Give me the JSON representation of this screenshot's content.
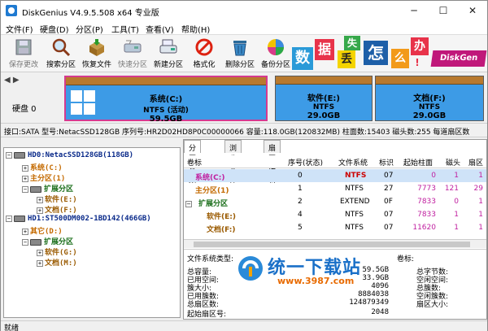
{
  "window": {
    "title": "DiskGenius V4.9.5.508 x64 专业版",
    "minimize": "─",
    "maximize": "☐",
    "close": "✕"
  },
  "menu": [
    "文件(F)",
    "硬盘(D)",
    "分区(P)",
    "工具(T)",
    "查看(V)",
    "帮助(H)"
  ],
  "toolbar": {
    "save": "保存更改",
    "search": "搜索分区",
    "recover": "恢复文件",
    "quick": "快速分区",
    "new": "新建分区",
    "format": "格式化",
    "delete": "删除分区",
    "backup": "备份分区"
  },
  "banner": {
    "c1": "数",
    "c2": "据",
    "c3": "丢",
    "c4": "失",
    "c5": "怎",
    "c6": "么",
    "c7": "办",
    "c8": "!",
    "brand": "DiskGen"
  },
  "disk": {
    "nav": "◀ ▶",
    "label": "硬盘 0",
    "partitions": [
      {
        "name": "系统(C:)",
        "fs": "NTFS (活动)",
        "size": "59.5GB"
      },
      {
        "name": "软件(E:)",
        "fs": "NTFS",
        "size": "29.0GB"
      },
      {
        "name": "文档(F:)",
        "fs": "NTFS",
        "size": "29.0GB"
      }
    ],
    "info": "接口:SATA  型号:NetacSSD128GB  序列号:HR2D02HD8P0C00000066  容量:118.0GB(120832MB)  柱面数:15403  磁头数:255  每道扇区数"
  },
  "tree": {
    "hd0": "HD0:NetacSSD128GB(118GB)",
    "sys": "系统(C:)",
    "primary": "主分区(1)",
    "ext": "扩展分区",
    "sw": "软件(E:)",
    "doc": "文档(F:)",
    "hd1": "HD1:ST500DM002-1BD142(466GB)",
    "other": "其它(D:)",
    "ext2": "扩展分区",
    "sw2": "软件(G:)",
    "doc2": "文档(M:)"
  },
  "tabs": [
    "分区参数",
    "浏览文件",
    "扇区编辑"
  ],
  "table": {
    "headers": [
      "卷标",
      "序号(状态)",
      "文件系统",
      "标识",
      "起始柱面",
      "磁头",
      "扇区"
    ],
    "rows": [
      {
        "label": "系统(C:)",
        "no": "0",
        "fs": "NTFS",
        "id": "07",
        "cyl": "0",
        "head": "1",
        "sec": "1"
      },
      {
        "label": "主分区(1)",
        "no": "1",
        "fs": "NTFS",
        "id": "27",
        "cyl": "7773",
        "head": "121",
        "sec": "29"
      },
      {
        "label": "扩展分区",
        "no": "2",
        "fs": "EXTEND",
        "id": "0F",
        "cyl": "7833",
        "head": "0",
        "sec": "1"
      },
      {
        "label": "软件(E:)",
        "no": "4",
        "fs": "NTFS",
        "id": "07",
        "cyl": "7833",
        "head": "1",
        "sec": "1"
      },
      {
        "label": "文档(F:)",
        "no": "5",
        "fs": "NTFS",
        "id": "07",
        "cyl": "11620",
        "head": "1",
        "sec": "1"
      }
    ]
  },
  "details": {
    "fstype": "文件系统类型:",
    "fstype_r": "卷标:",
    "total": "总容量:",
    "total_v": "59.5GB",
    "total_r": "总字节数:",
    "free": "已用空间:",
    "free_v": "33.9GB",
    "free_r": "空闲空间:",
    "cluster": "簇大小:",
    "cluster_v": "4096",
    "cluster_r": "总簇数:",
    "used": "已用簇数:",
    "used_v": "8884038",
    "used_r": "空闲簇数:",
    "sectors": "总扇区数:",
    "sectors_v": "124879349",
    "sectors_r": "扇区大小:",
    "start": "起始扇区号:",
    "start_v": "2048"
  },
  "watermark": {
    "main": "统一下载站",
    "url": "www.3987.com"
  },
  "status": "就绪",
  "colors": {
    "partition": "#3d9be6",
    "selected_border": "#d63a8f",
    "partition_top": "#b8792e"
  }
}
